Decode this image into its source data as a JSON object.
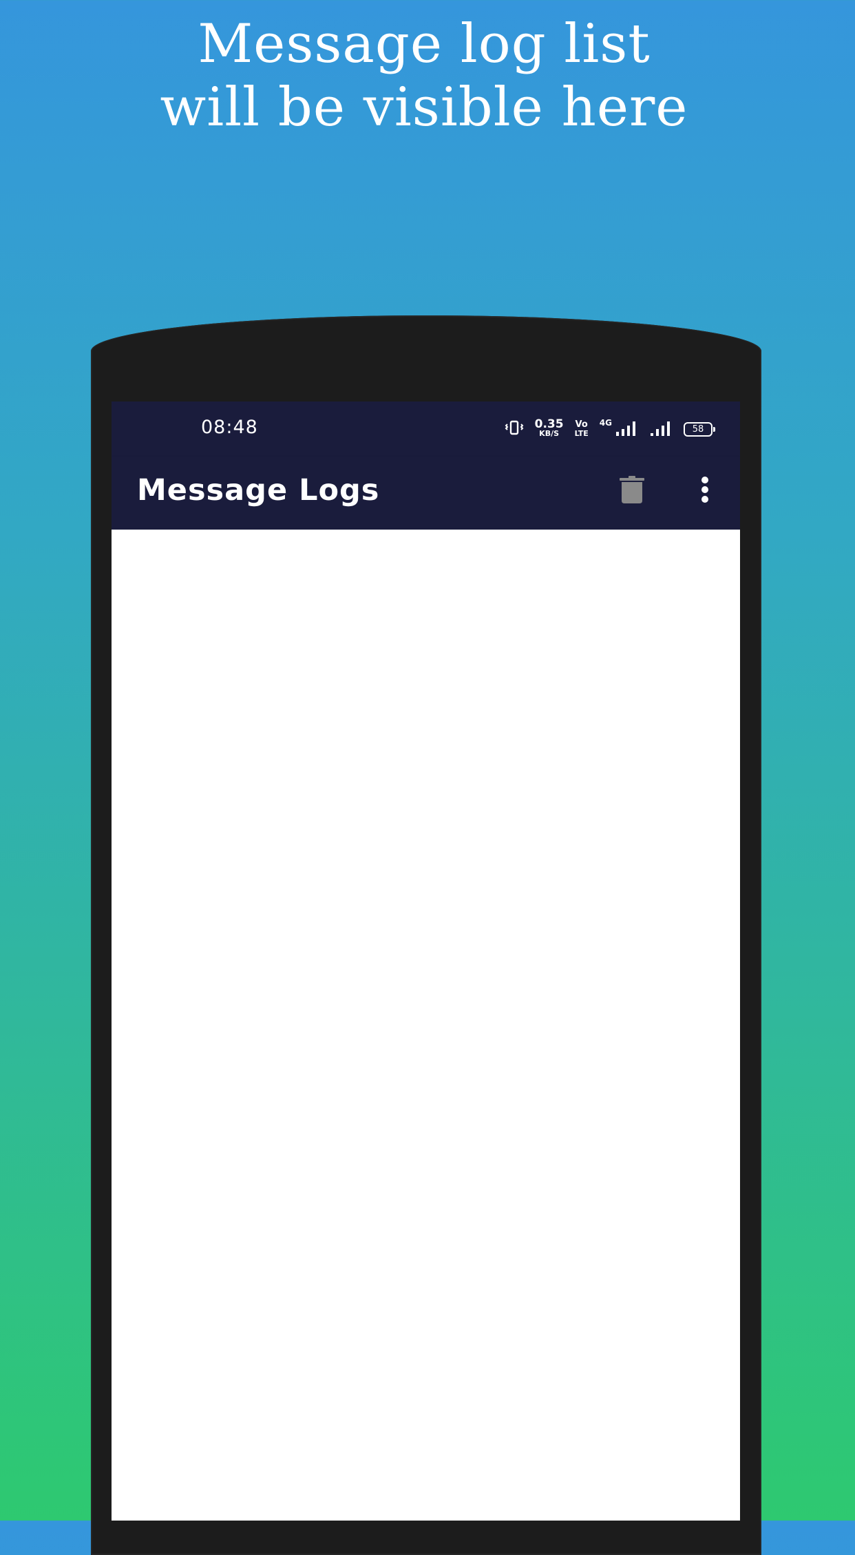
{
  "promo": {
    "line1": "Message log list",
    "line2": "will be visible here"
  },
  "status_bar": {
    "time": "08:48",
    "net_speed_value": "0.35",
    "net_speed_unit": "KB/S",
    "volte_top": "Vo",
    "volte_bottom": "LTE",
    "network_type": "4G",
    "battery_level": "58",
    "icons": [
      "vibrate-icon",
      "signal-icon",
      "signal-icon",
      "battery-icon"
    ]
  },
  "app_bar": {
    "title": "Message Logs",
    "actions": [
      "delete-icon",
      "more-vert-icon"
    ]
  },
  "colors": {
    "gradient_top": "#3596dc",
    "gradient_bottom": "#2ec970",
    "app_bar": "#1a1c3c",
    "phone_frame": "#1c1c1c",
    "delete_icon": "#8a8a8a"
  }
}
